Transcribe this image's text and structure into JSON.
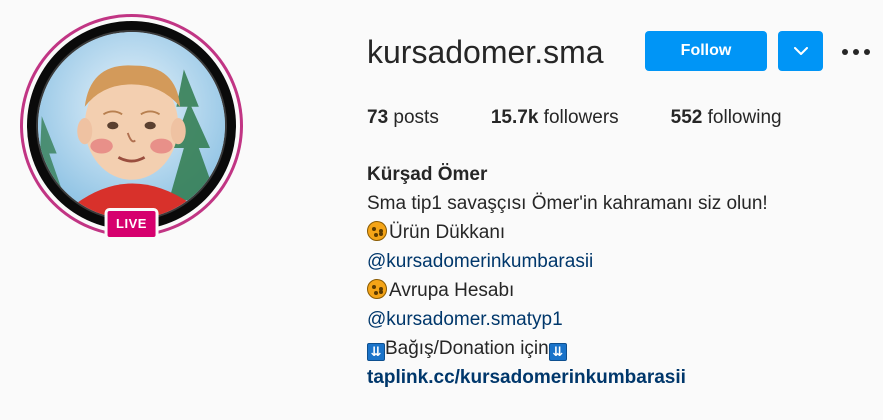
{
  "profile": {
    "username": "kursadomer.sma",
    "live_label": "LIVE",
    "follow_label": "Follow"
  },
  "stats": {
    "posts_count": "73",
    "posts_label": "posts",
    "followers_count": "15.7k",
    "followers_label": "followers",
    "following_count": "552",
    "following_label": "following"
  },
  "bio": {
    "full_name": "Kürşad Ömer",
    "line1": "Sma tip1 savaşçısı Ömer'in kahramanı siz olun!",
    "line2": "Ürün Dükkanı",
    "line3": "@kursadomerinkumbarasii",
    "line4": "Avrupa Hesabı",
    "line5": "@kursadomer.smatyp1",
    "line6": "Bağış/Donation için",
    "website": "taplink.cc/kursadomerinkumbarasii",
    "emoji_cookie": "cookie-icon",
    "emoji_arrow": "double-down-arrow-icon"
  },
  "colors": {
    "accent": "#0095f6",
    "live_ring": "#c13584",
    "live_badge": "#d6006e",
    "link": "#00376b"
  }
}
